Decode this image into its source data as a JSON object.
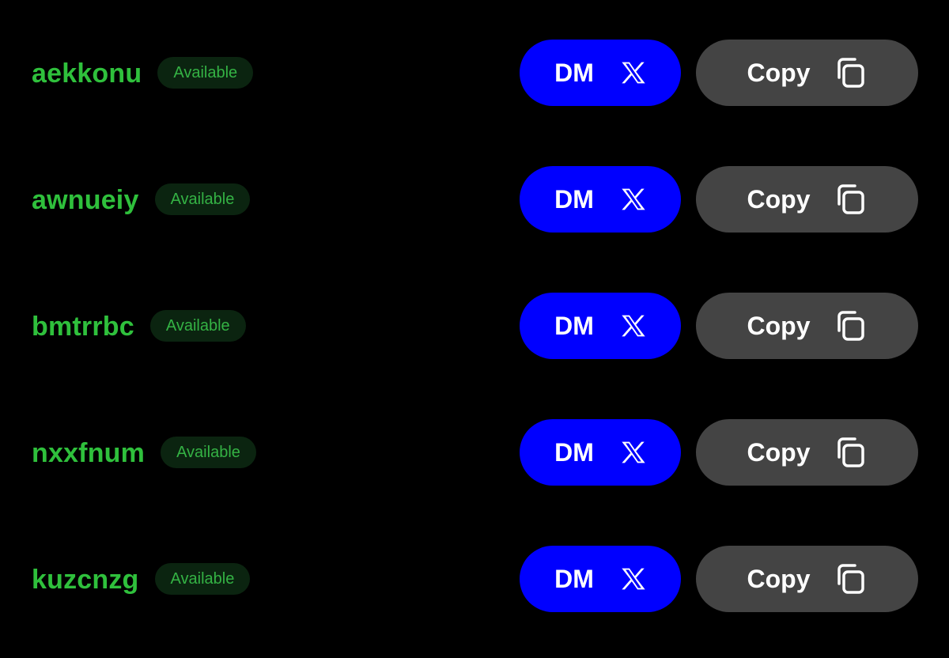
{
  "theme": {
    "background": "#000000",
    "username_color": "#2fc03c",
    "badge_background": "#0b2410",
    "badge_text_color": "#34b244",
    "dm_button_color": "#0000ff",
    "copy_button_color": "#444444"
  },
  "rows": [
    {
      "username": "aekkonu",
      "status": "Available",
      "dm_label": "DM",
      "dm_icon": "x-logo-icon",
      "copy_label": "Copy",
      "copy_icon": "copy-icon"
    },
    {
      "username": "awnueiy",
      "status": "Available",
      "dm_label": "DM",
      "dm_icon": "x-logo-icon",
      "copy_label": "Copy",
      "copy_icon": "copy-icon"
    },
    {
      "username": "bmtrrbc",
      "status": "Available",
      "dm_label": "DM",
      "dm_icon": "x-logo-icon",
      "copy_label": "Copy",
      "copy_icon": "copy-icon"
    },
    {
      "username": "nxxfnum",
      "status": "Available",
      "dm_label": "DM",
      "dm_icon": "x-logo-icon",
      "copy_label": "Copy",
      "copy_icon": "copy-icon"
    },
    {
      "username": "kuzcnzg",
      "status": "Available",
      "dm_label": "DM",
      "dm_icon": "x-logo-icon",
      "copy_label": "Copy",
      "copy_icon": "copy-icon"
    }
  ]
}
